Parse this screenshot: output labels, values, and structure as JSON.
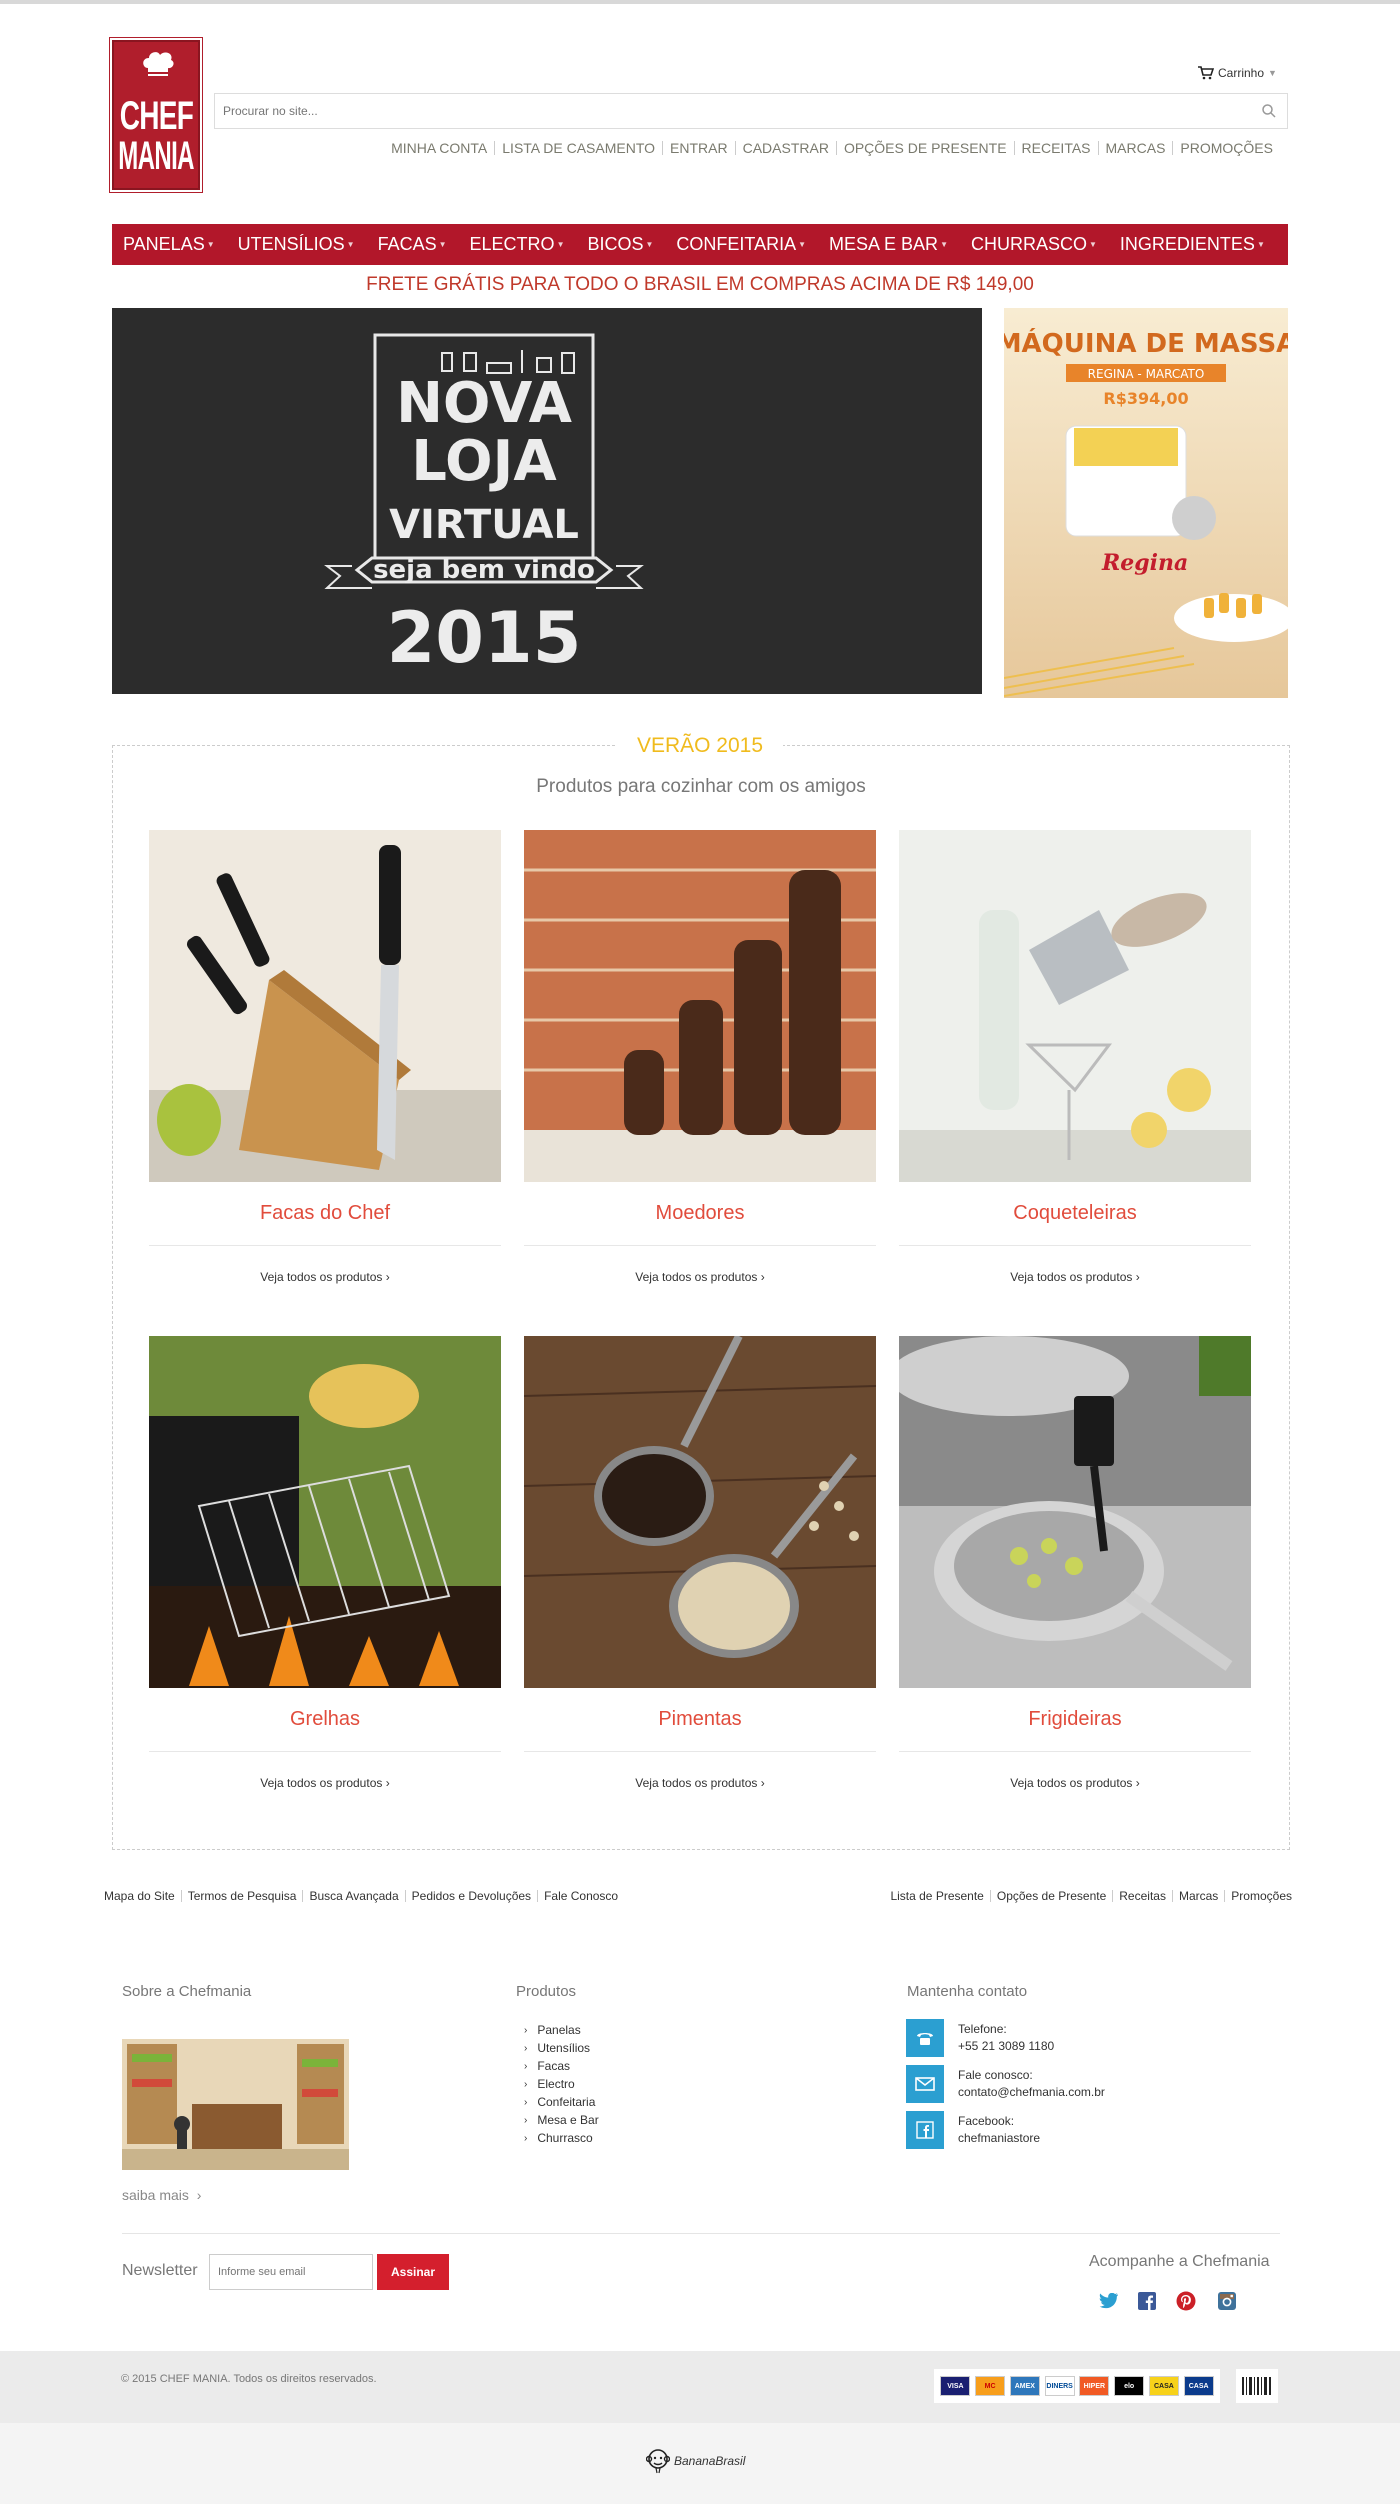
{
  "header": {
    "logo_line1": "CHEF",
    "logo_line2": "MANIA",
    "cart_label": "Carrinho",
    "search_placeholder": "Procurar no site...",
    "top_links": [
      "MINHA CONTA",
      "LISTA DE CASAMENTO",
      "ENTRAR",
      "CADASTRAR",
      "OPÇÕES DE PRESENTE",
      "RECEITAS",
      "MARCAS",
      "PROMOÇÕES"
    ]
  },
  "nav": {
    "items": [
      "PANELAS",
      "UTENSÍLIOS",
      "FACAS",
      "ELECTRO",
      "BICOS",
      "CONFEITARIA",
      "MESA E BAR",
      "CHURRASCO",
      "INGREDIENTES"
    ]
  },
  "freight_notice": "FRETE GRÁTIS PARA TODO O BRASIL EM COMPRAS ACIMA DE R$ 149,00",
  "banner_main": {
    "line1": "NOVA",
    "line2": "LOJA",
    "line3": "VIRTUAL",
    "ribbon": "seja bem vindo",
    "year": "2015"
  },
  "banner_side": {
    "title": "MÁQUINA DE MASSA",
    "subtitle": "REGINA - MARCATO",
    "price": "R$394,00",
    "brand": "Regina"
  },
  "section": {
    "title": "VERÃO 2015",
    "subtitle": "Produtos para cozinhar com os amigos",
    "products": [
      {
        "name": "Facas do Chef",
        "link": "Veja todos os produtos"
      },
      {
        "name": "Moedores",
        "link": "Veja todos os produtos"
      },
      {
        "name": "Coqueteleiras",
        "link": "Veja todos os produtos"
      },
      {
        "name": "Grelhas",
        "link": "Veja todos os produtos"
      },
      {
        "name": "Pimentas",
        "link": "Veja todos os produtos"
      },
      {
        "name": "Frigideiras",
        "link": "Veja todos os produtos"
      }
    ]
  },
  "footer_links_left": [
    "Mapa do Site",
    "Termos de Pesquisa",
    "Busca Avançada",
    "Pedidos e Devoluções",
    "Fale Conosco"
  ],
  "footer_links_right": [
    "Lista de Presente",
    "Opções de Presente",
    "Receitas",
    "Marcas",
    "Promoções"
  ],
  "about": {
    "title": "Sobre a Chefmania",
    "more": "saiba mais"
  },
  "products_col": {
    "title": "Produtos",
    "items": [
      "Panelas",
      "Utensílios",
      "Facas",
      "Electro",
      "Confeitaria",
      "Mesa e Bar",
      "Churrasco"
    ]
  },
  "contact": {
    "title": "Mantenha contato",
    "phone_label": "Telefone:",
    "phone": "+55 21 3089 1180",
    "email_label": "Fale conosco:",
    "email": "contato@chefmania.com.br",
    "facebook_label": "Facebook:",
    "facebook": "chefmaniastore"
  },
  "newsletter": {
    "label": "Newsletter",
    "placeholder": "Informe seu email",
    "button": "Assinar"
  },
  "follow": {
    "title": "Acompanhe a Chefmania"
  },
  "copyright": "© 2015 CHEF MANIA. Todos os direitos reservados.",
  "payment_cards": [
    "VISA",
    "MC",
    "AMEX",
    "DINERS",
    "HIPER",
    "elo",
    "CASA",
    "CASA"
  ],
  "credit": "BananaBrasil",
  "colors": {
    "brand_red": "#b2172a",
    "accent_yellow": "#f0bb1d",
    "product_red": "#e14c3c",
    "contact_blue": "#2b9fd1"
  }
}
